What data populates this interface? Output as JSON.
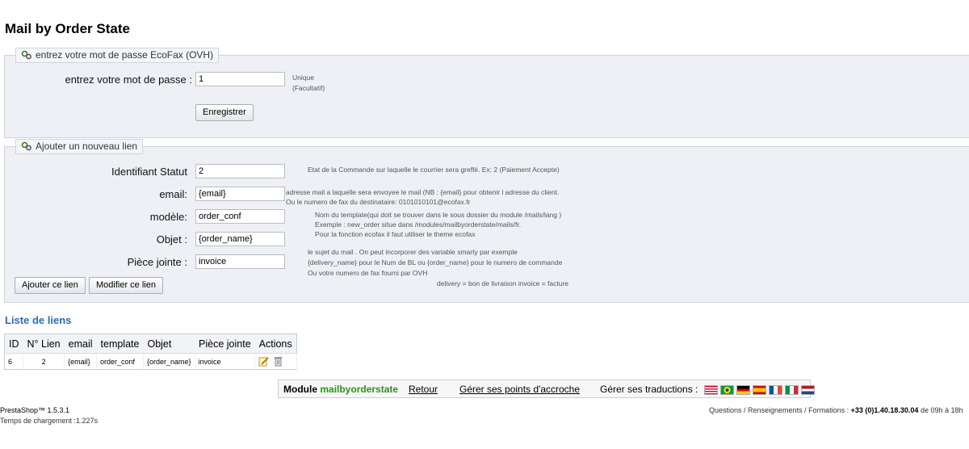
{
  "page": {
    "title": "Mail by Order State"
  },
  "ecofax": {
    "legend": "entrez votre mot de passe EcoFax (OVH)",
    "password_label": "entrez votre mot de passe :",
    "password_value": "1",
    "hint_line1": "Unique",
    "hint_line2": "(Facultatif)",
    "save_button": "Enregistrer"
  },
  "new_link": {
    "legend": "Ajouter un nouveau lien",
    "status_label": "Identifiant Statut",
    "status_value": "2",
    "status_hint": "Etat de la Commande sur laquelle le courrier sera greffé. Ex: 2 (Paiement Accepte)",
    "email_label": "email:",
    "email_value": "{email}",
    "email_hint1": "adresse mail a laquelle sera envoyee le mail (NB : {email} pour obtenir l adresse du client.",
    "email_hint2": "Ou le numero de fax du destinataire: 0101010101@ecofax.fr",
    "template_label": "modèle:",
    "template_value": "order_conf",
    "template_hint1": "Nom du template(qui doit se trouver dans le sous dossier du module /mails/lang )",
    "template_hint2": "Exemple : new_order situe dans /modules/mailbyorderstate/mails/fr.",
    "template_hint3": "Pour la fonction ecofax il faut utiliser le theme ecofax",
    "subject_label": "Objet :",
    "subject_value": "{order_name}",
    "subject_hint1": "le sujet du mail . On peut incorporer des variable smarty par exemple",
    "subject_hint2": "{delivery_name} pour le Num de BL ou {order_name} pour le numero de commande",
    "subject_hint3": "Ou votre numero de fax fourni par OVH",
    "attachment_label": "Pièce jointe :",
    "attachment_value": "invoice",
    "attachment_hint": "delivery = bon de livraison invoice = facture",
    "add_button": "Ajouter ce lien",
    "modify_button": "Modifier ce lien"
  },
  "links_list": {
    "title": "Liste de liens",
    "headers": [
      "ID",
      "N° Lien",
      "email",
      "template",
      "Objet",
      "Pièce jointe",
      "Actions"
    ],
    "rows": [
      {
        "id": "6",
        "link_no": "2",
        "email": "{email}",
        "template": "order_conf",
        "subject": "{order_name}",
        "attachment": "invoice"
      }
    ]
  },
  "footer_bar": {
    "module_prefix": "Module",
    "module_name": "mailbyorderstate",
    "back": "Retour",
    "hooks": "Gérer ses points d'accroche",
    "translations": "Gérer ses traductions :",
    "flags": [
      "en",
      "br",
      "de",
      "es",
      "fr",
      "it",
      "nl"
    ]
  },
  "footer": {
    "version": "PrestaShop™ 1.5.3.1",
    "load_time": "Temps de chargement :1.227s",
    "contact_prefix": "Questions / Renseignements / Formations :",
    "contact_phone": "+33 (0)1.40.18.30.04",
    "contact_suffix": "de 09h à 18h"
  },
  "colors": {
    "accent": "#2b6cb0",
    "module_green": "#2f8f1f",
    "fieldset_bg": "#eef0f5"
  }
}
